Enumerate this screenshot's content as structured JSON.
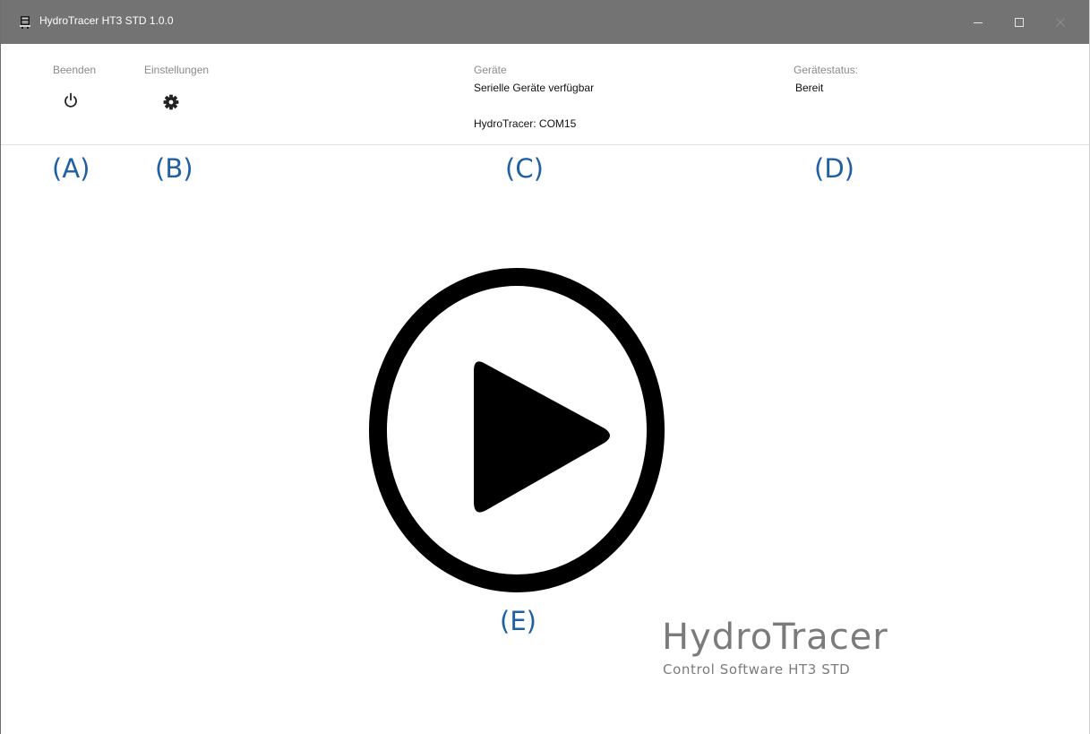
{
  "window": {
    "title": "HydroTracer HT3 STD 1.0.0",
    "titlebar_color": "#737373"
  },
  "toolbar": {
    "quit_label": "Beenden",
    "quit_icon": "power-icon",
    "settings_label": "Einstellungen",
    "settings_icon": "gear-icon"
  },
  "devices": {
    "label": "Geräte",
    "serial_status": "Serielle Geräte verfügbar",
    "port": "HydroTracer: COM15"
  },
  "device_status": {
    "label": "Gerätestatus:",
    "value": "Bereit"
  },
  "annotations": {
    "a": "(A)",
    "b": "(B)",
    "c": "(C)",
    "d": "(D)",
    "e": "(E)",
    "color": "#1f5fa4"
  },
  "main": {
    "play_icon": "play-circle-icon"
  },
  "branding": {
    "title": "HydroTracer",
    "subtitle": "Control Software HT3 STD"
  }
}
